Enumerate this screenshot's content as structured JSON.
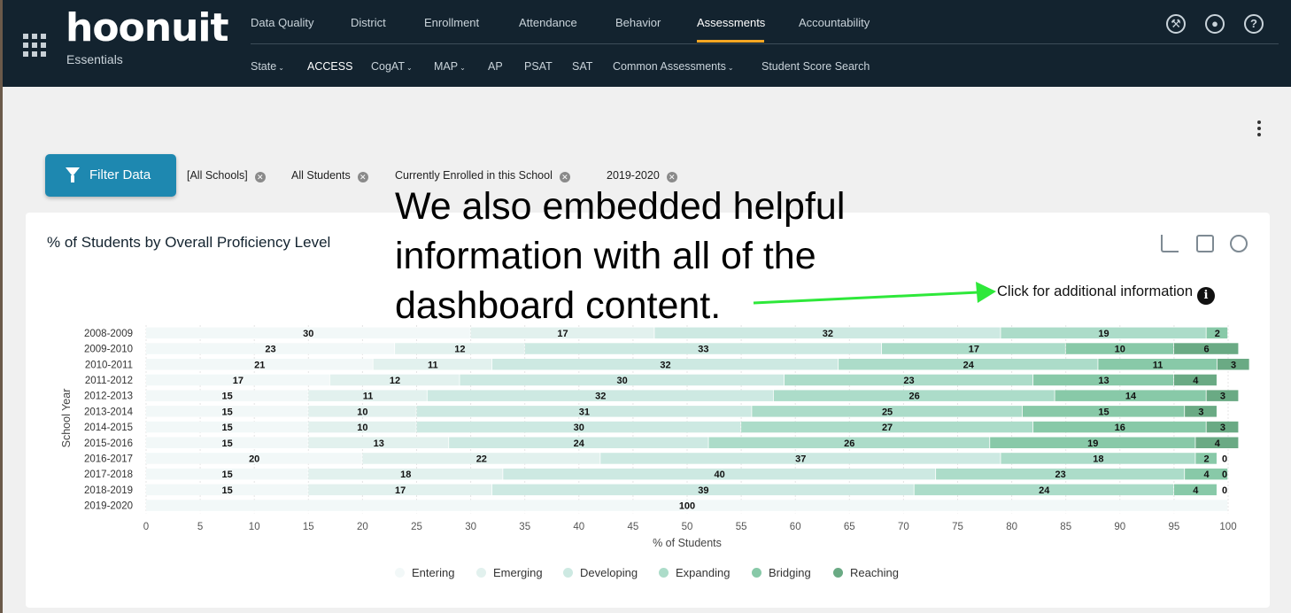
{
  "header": {
    "logo": "hoonuit",
    "logo_sub": "Essentials",
    "main_nav": [
      "Data Quality",
      "District",
      "Enrollment",
      "Attendance",
      "Behavior",
      "Assessments",
      "Accountability"
    ],
    "active_main": "Assessments",
    "sub_nav": [
      "State",
      "ACCESS",
      "CogAT",
      "MAP",
      "AP",
      "PSAT",
      "SAT",
      "Common Assessments",
      "Student Score Search"
    ],
    "sub_nav_dropdown": [
      true,
      false,
      true,
      true,
      false,
      false,
      false,
      true,
      false
    ],
    "active_sub": "ACCESS",
    "icons": [
      "wrench-icon",
      "user-icon",
      "help-icon"
    ],
    "accent_color": "#f5a623"
  },
  "filters": {
    "button_label": "Filter Data",
    "chips": [
      "[All Schools]",
      "All Students",
      "Currently Enrolled in this School",
      "2019-2020"
    ]
  },
  "card": {
    "title": "% of Students by Overall Proficiency Level",
    "info_link": "Click for additional information",
    "info_icon_glyph": "i"
  },
  "overlay_text": [
    "We also embedded helpful",
    "information with all of the",
    "dashboard content."
  ],
  "chart_data": {
    "type": "bar",
    "orientation": "horizontal",
    "stacked": true,
    "xlabel": "% of Students",
    "ylabel": "School Year",
    "xlim": [
      0,
      100
    ],
    "xticks": [
      0,
      5,
      10,
      15,
      20,
      25,
      30,
      35,
      40,
      45,
      50,
      55,
      60,
      65,
      70,
      75,
      80,
      85,
      90,
      95,
      100
    ],
    "categories": [
      "2008-2009",
      "2009-2010",
      "2010-2011",
      "2011-2012",
      "2012-2013",
      "2013-2014",
      "2014-2015",
      "2015-2016",
      "2016-2017",
      "2017-2018",
      "2018-2019",
      "2019-2020"
    ],
    "series": [
      {
        "name": "Entering",
        "color": "#f2f8f8",
        "values": [
          30,
          23,
          21,
          17,
          15,
          15,
          15,
          15,
          20,
          15,
          15,
          100
        ]
      },
      {
        "name": "Emerging",
        "color": "#e2f1ee",
        "values": [
          17,
          12,
          11,
          12,
          11,
          10,
          10,
          13,
          22,
          18,
          17,
          0
        ]
      },
      {
        "name": "Developing",
        "color": "#cde9e2",
        "values": [
          32,
          33,
          32,
          30,
          32,
          31,
          30,
          24,
          37,
          40,
          39,
          0
        ]
      },
      {
        "name": "Expanding",
        "color": "#acdcc9",
        "values": [
          19,
          17,
          24,
          23,
          26,
          25,
          27,
          26,
          18,
          23,
          24,
          0
        ]
      },
      {
        "name": "Bridging",
        "color": "#88c9a8",
        "values": [
          2,
          10,
          11,
          13,
          14,
          15,
          16,
          19,
          2,
          4,
          4,
          0
        ]
      },
      {
        "name": "Reaching",
        "color": "#6aaa84",
        "values": [
          0,
          6,
          3,
          4,
          3,
          3,
          3,
          4,
          0,
          0,
          0,
          0
        ]
      }
    ],
    "grid": true,
    "legend_position": "bottom"
  },
  "page_menu_icon": "kebab-menu-icon"
}
